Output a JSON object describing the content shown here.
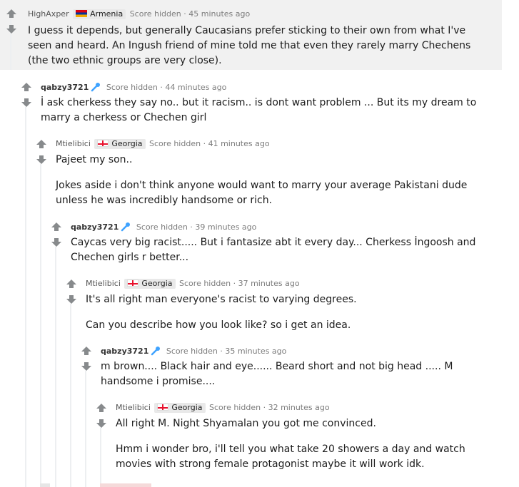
{
  "comments": [
    {
      "author": "HighAxper",
      "flair": "Armenia",
      "score": "Score hidden",
      "sep": "·",
      "time": "45 minutes ago",
      "paragraphs": [
        "I guess it depends, but generally Caucasians prefer sticking to their own from what I've seen and heard. An Ingush friend of mine told me that even they rarely marry Chechens (the two ethnic groups are very close)."
      ]
    },
    {
      "author": "qabzy3721",
      "flair": "",
      "score": "Score hidden",
      "sep": "·",
      "time": "44 minutes ago",
      "paragraphs": [
        "İ ask cherkess they say no.. but it racism.. is dont want problem ... But its my dream to marry a cherkess or Chechen girl"
      ]
    },
    {
      "author": "Mtielibici",
      "flair": "Georgia",
      "score": "Score hidden",
      "sep": "·",
      "time": "41 minutes ago",
      "paragraphs": [
        "Pajeet my son..",
        "Jokes aside i don't think anyone would want to marry your average Pakistani dude unless he was incredibly handsome or rich."
      ]
    },
    {
      "author": "qabzy3721",
      "flair": "",
      "score": "Score hidden",
      "sep": "·",
      "time": "39 minutes ago",
      "paragraphs": [
        "Caycas very big racist..... But i fantasize abt it every day... Cherkess İngoosh and Chechen girls r better..."
      ]
    },
    {
      "author": "Mtielibici",
      "flair": "Georgia",
      "score": "Score hidden",
      "sep": "·",
      "time": "37 minutes ago",
      "paragraphs": [
        "It's all right man everyone's racist to varying degrees.",
        "Can you describe how you look like? so i get an idea."
      ]
    },
    {
      "author": "qabzy3721",
      "flair": "",
      "score": "Score hidden",
      "sep": "·",
      "time": "35 minutes ago",
      "paragraphs": [
        "m brown.... Black hair and eye...... Beard short and not big head ..... M handsome i promise...."
      ]
    },
    {
      "author": "Mtielibici",
      "flair": "Georgia",
      "score": "Score hidden",
      "sep": "·",
      "time": "32 minutes ago",
      "paragraphs": [
        "All right M. Night Shyamalan you got me convinced.",
        "Hmm i wonder bro, i'll tell you what take 20 showers a day and watch movies with strong female protagonist maybe it will work idk."
      ]
    }
  ],
  "icons": {
    "upvote": "upvote-arrow-icon",
    "downvote": "downvote-arrow-icon",
    "op_badge": "wrench-icon",
    "flag_armenia": "armenia-flag-icon",
    "flag_georgia": "georgia-flag-icon"
  },
  "colors": {
    "highlight_bg": "#f1f1f1",
    "arrow": "#878a8c",
    "meta": "#7c7c7c",
    "op_badge": "#3fa3ff",
    "thread_line": "#edeff1"
  }
}
